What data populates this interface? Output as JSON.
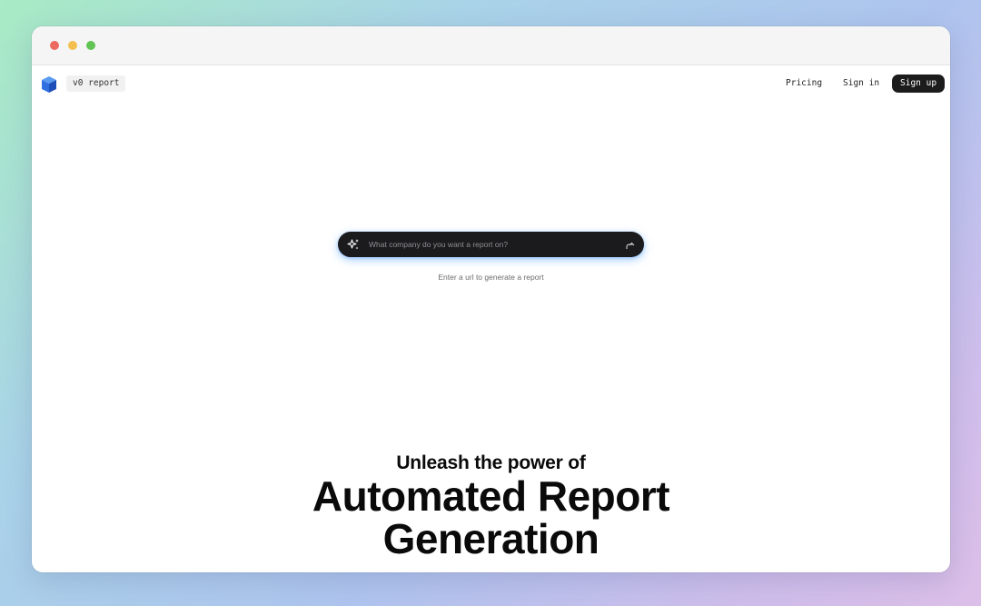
{
  "brand": {
    "name": "v0 report"
  },
  "nav": {
    "pricing": "Pricing",
    "signin": "Sign in",
    "signup": "Sign up"
  },
  "search": {
    "placeholder": "What company do you want a report on?",
    "value": "",
    "hint": "Enter a url to generate a report",
    "icon": "sparkle-icon",
    "submit_icon": "arrow-up-icon"
  },
  "hero": {
    "subtitle": "Unleash the power of",
    "title": "Automated Report\nGeneration"
  },
  "colors": {
    "accent": "#1b1b1d",
    "logo": "#2f6fe0",
    "glow": "#60aaff"
  }
}
